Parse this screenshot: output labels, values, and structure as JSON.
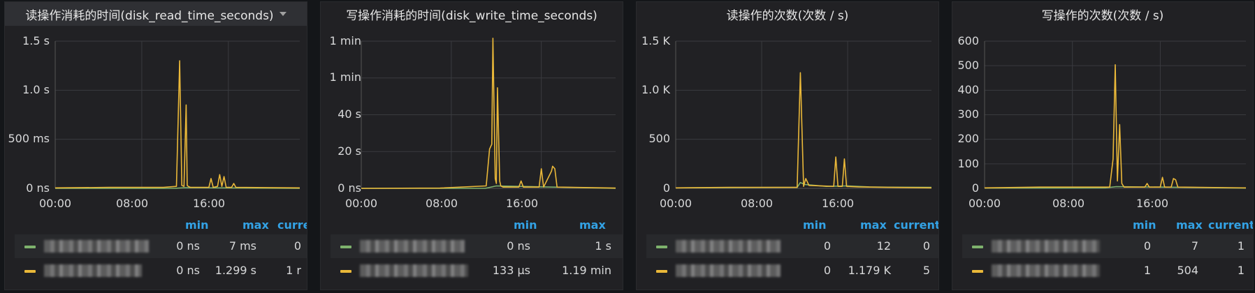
{
  "panels": [
    {
      "title": "读操作消耗的时间(disk_read_time_seconds)",
      "y_ticks": [
        "1.5 s",
        "1.0 s",
        "500 ms",
        "0 ns"
      ],
      "x_ticks": [
        "00:00",
        "08:00",
        "16:00"
      ],
      "legend_headers": [
        "min",
        "max",
        "curre"
      ],
      "legend_rows": [
        {
          "color": "#7eb26d",
          "values": [
            "0 ns",
            "7 ms",
            "0"
          ]
        },
        {
          "color": "#eab839",
          "values": [
            "0 ns",
            "1.299 s",
            "1 r"
          ]
        }
      ]
    },
    {
      "title": "写操作消耗的时间(disk_write_time_seconds)",
      "y_ticks": [
        "1 min",
        "1 min",
        "40 s",
        "20 s",
        "0 ns"
      ],
      "x_ticks": [
        "00:00",
        "08:00",
        "16:00"
      ],
      "legend_headers": [
        "min",
        "max"
      ],
      "legend_rows": [
        {
          "color": "#7eb26d",
          "values": [
            "0 ns",
            "1 s"
          ]
        },
        {
          "color": "#eab839",
          "values": [
            "133 µs",
            "1.19 min"
          ]
        }
      ]
    },
    {
      "title": "读操作的次数(次数 / s)",
      "y_ticks": [
        "1.5 K",
        "1.0 K",
        "500",
        "0"
      ],
      "x_ticks": [
        "00:00",
        "08:00",
        "16:00"
      ],
      "legend_headers": [
        "min",
        "max",
        "current"
      ],
      "legend_rows": [
        {
          "color": "#7eb26d",
          "values": [
            "0",
            "12",
            "0"
          ]
        },
        {
          "color": "#eab839",
          "values": [
            "0",
            "1.179 K",
            "5"
          ]
        }
      ]
    },
    {
      "title": "写操作的次数(次数 / s)",
      "y_ticks": [
        "600",
        "500",
        "400",
        "300",
        "200",
        "100",
        "0"
      ],
      "x_ticks": [
        "00:00",
        "08:00",
        "16:00"
      ],
      "legend_headers": [
        "min",
        "max",
        "current"
      ],
      "legend_rows": [
        {
          "color": "#7eb26d",
          "values": [
            "0",
            "7",
            "1"
          ]
        },
        {
          "color": "#eab839",
          "values": [
            "1",
            "504",
            "1"
          ]
        }
      ]
    }
  ],
  "chart_data": [
    {
      "type": "line",
      "title": "读操作消耗的时间(disk_read_time_seconds)",
      "unit": "seconds",
      "ylim": [
        0,
        1.5
      ],
      "xlim_hours": [
        0,
        22.6
      ],
      "series": [
        {
          "color": "#7eb26d",
          "x": [
            0,
            11,
            12,
            22.6
          ],
          "y": [
            0,
            0,
            0.007,
            0
          ]
        },
        {
          "color": "#eab839",
          "x": [
            0,
            5,
            10,
            11.2,
            11.5,
            11.7,
            11.9,
            12.1,
            12.2,
            12.3,
            12.5,
            14.2,
            14.4,
            14.6,
            15.0,
            15.2,
            15.4,
            15.6,
            15.8,
            16.3,
            16.5,
            16.7,
            22.6
          ],
          "y": [
            0.005,
            0.01,
            0.01,
            0.02,
            1.3,
            0.03,
            0.02,
            0.85,
            0.03,
            0.02,
            0.01,
            0.01,
            0.1,
            0.01,
            0.02,
            0.14,
            0.02,
            0.12,
            0.01,
            0.01,
            0.05,
            0.01,
            0.005
          ]
        }
      ]
    },
    {
      "type": "line",
      "title": "写操作消耗的时间(disk_write_time_seconds)",
      "unit": "seconds",
      "ylim": [
        0,
        60
      ],
      "xlim_hours": [
        0,
        22.6
      ],
      "series": [
        {
          "color": "#7eb26d",
          "x": [
            0,
            11,
            12,
            22.6
          ],
          "y": [
            0,
            0,
            1,
            0
          ]
        },
        {
          "color": "#eab839",
          "x": [
            0,
            7,
            11.1,
            11.4,
            11.6,
            11.7,
            11.9,
            12.0,
            12.1,
            12.3,
            12.4,
            12.6,
            14.0,
            14.2,
            14.4,
            15.8,
            16.0,
            16.2,
            16.9,
            17.0,
            17.2,
            17.4,
            22.6
          ],
          "y": [
            0,
            0.1,
            1,
            16,
            18,
            71,
            4,
            2,
            41,
            3,
            1,
            0.5,
            0.5,
            3,
            0.5,
            0.5,
            8,
            0.5,
            7,
            9,
            8,
            0.5,
            0.1
          ]
        }
      ]
    },
    {
      "type": "line",
      "title": "读操作的次数(次数 / s)",
      "unit": "count/s",
      "ylim": [
        0,
        1500
      ],
      "xlim_hours": [
        0,
        23.8
      ],
      "series": [
        {
          "color": "#7eb26d",
          "x": [
            0,
            5,
            11.3,
            11.6,
            12.0,
            13.0,
            14.0,
            16.0,
            18.0,
            20.0,
            23.8
          ],
          "y": [
            5,
            8,
            10,
            60,
            40,
            30,
            20,
            25,
            15,
            12,
            10
          ]
        },
        {
          "color": "#eab839",
          "x": [
            0,
            5,
            11.3,
            11.6,
            11.9,
            12.1,
            12.4,
            14.7,
            14.9,
            15.1,
            15.5,
            15.7,
            15.9,
            17,
            20,
            23.8
          ],
          "y": [
            5,
            10,
            10,
            1179,
            20,
            100,
            30,
            20,
            320,
            20,
            20,
            300,
            20,
            15,
            10,
            5
          ]
        }
      ]
    },
    {
      "type": "line",
      "title": "写操作的次数(次数 / s)",
      "unit": "count/s",
      "ylim": [
        0,
        600
      ],
      "xlim_hours": [
        0,
        23.8
      ],
      "series": [
        {
          "color": "#7eb26d",
          "x": [
            0,
            11,
            12,
            23.8
          ],
          "y": [
            1,
            2,
            7,
            1
          ]
        },
        {
          "color": "#eab839",
          "x": [
            0,
            5,
            11.4,
            11.7,
            11.9,
            12.1,
            12.3,
            12.5,
            12.7,
            14.6,
            14.8,
            15.0,
            16.0,
            16.2,
            16.4,
            17.0,
            17.2,
            17.4,
            17.6,
            23.8
          ],
          "y": [
            2,
            5,
            5,
            120,
            504,
            30,
            260,
            20,
            5,
            5,
            20,
            5,
            5,
            45,
            5,
            5,
            40,
            35,
            5,
            2
          ]
        }
      ]
    }
  ]
}
